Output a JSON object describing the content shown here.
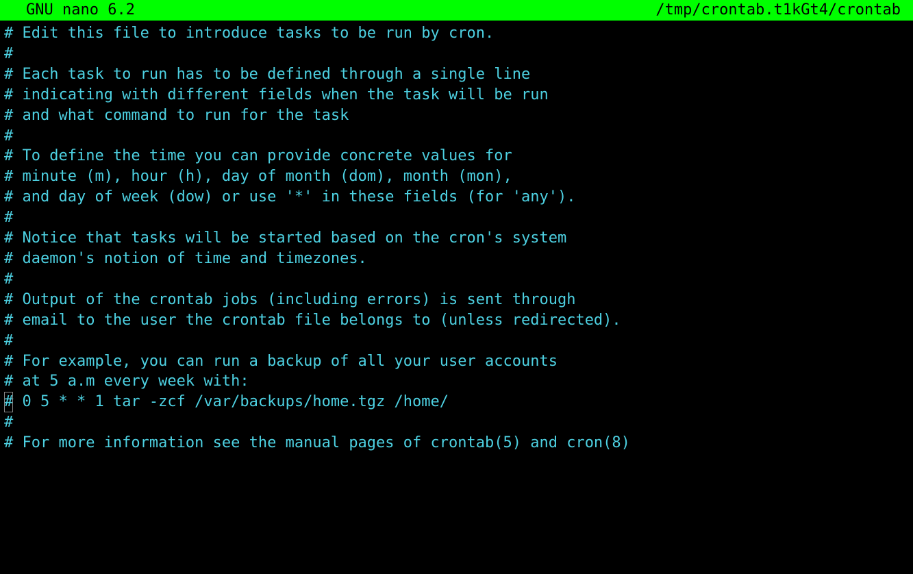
{
  "titlebar": {
    "app": "GNU nano",
    "version": "6.2",
    "filepath": "/tmp/crontab.t1kGt4/crontab"
  },
  "lines": [
    "# Edit this file to introduce tasks to be run by cron.",
    "#",
    "# Each task to run has to be defined through a single line",
    "# indicating with different fields when the task will be run",
    "# and what command to run for the task",
    "#",
    "# To define the time you can provide concrete values for",
    "# minute (m), hour (h), day of month (dom), month (mon),",
    "# and day of week (dow) or use '*' in these fields (for 'any').",
    "#",
    "# Notice that tasks will be started based on the cron's system",
    "# daemon's notion of time and timezones.",
    "#",
    "# Output of the crontab jobs (including errors) is sent through",
    "# email to the user the crontab file belongs to (unless redirected).",
    "#",
    "# For example, you can run a backup of all your user accounts",
    "# at 5 a.m every week with:",
    "# 0 5 * * 1 tar -zcf /var/backups/home.tgz /home/",
    "#",
    "# For more information see the manual pages of crontab(5) and cron(8)"
  ],
  "cursor_line_index": 18,
  "cursor_line_prefix": "",
  "cursor_char": "#",
  "cursor_line_suffix": " 0 5 * * 1 tar -zcf /var/backups/home.tgz /home/"
}
